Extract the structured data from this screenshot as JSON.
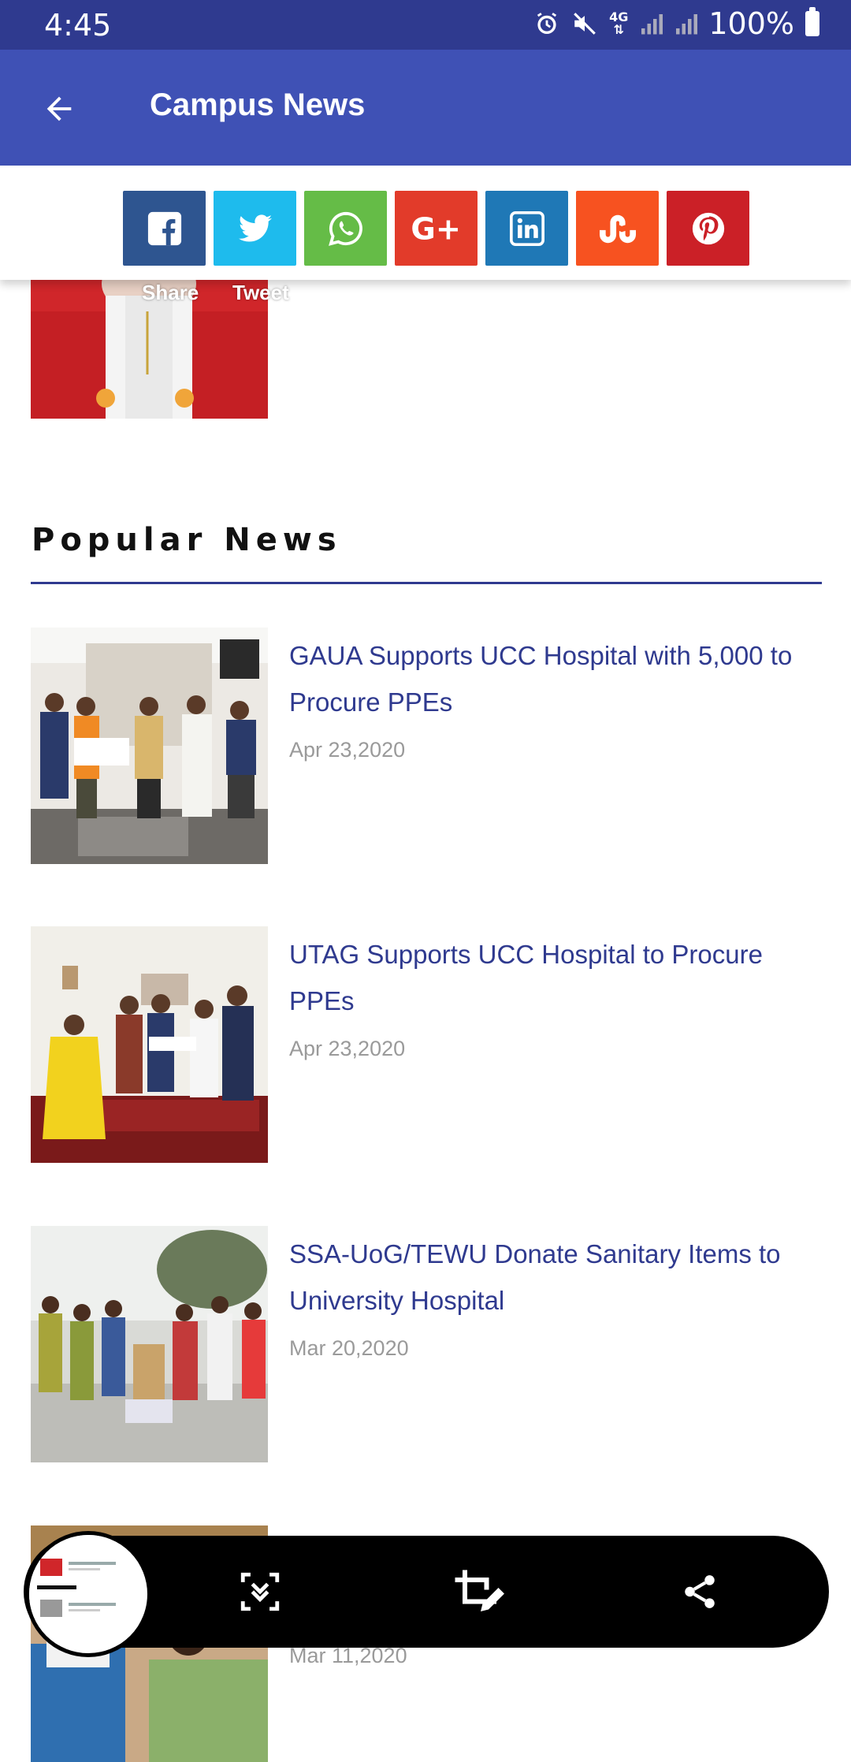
{
  "status_bar": {
    "time": "4:45",
    "network": "4G",
    "battery": "100%"
  },
  "app_bar": {
    "title": "Campus News",
    "back_icon": "arrow-back-icon"
  },
  "share_bar": {
    "buttons": [
      {
        "name": "facebook",
        "icon": "facebook-icon",
        "color": "#2e5590"
      },
      {
        "name": "twitter",
        "icon": "twitter-icon",
        "color": "#1ebbed"
      },
      {
        "name": "whatsapp",
        "icon": "whatsapp-icon",
        "color": "#65bc47"
      },
      {
        "name": "google-plus",
        "icon": "google-plus-icon",
        "color": "#e23b2a"
      },
      {
        "name": "linkedin",
        "icon": "linkedin-icon",
        "color": "#1f78b6"
      },
      {
        "name": "stumbleupon",
        "icon": "stumbleupon-icon",
        "color": "#f75220"
      },
      {
        "name": "pinterest",
        "icon": "pinterest-icon",
        "color": "#cb2027"
      }
    ],
    "captions": {
      "share": "Share",
      "tweet": "Tweet"
    }
  },
  "popular": {
    "heading": "Popular News",
    "items": [
      {
        "title": "GAUA Supports UCC Hospital with 5,000 to Procure PPEs",
        "date": "Apr 23,2020"
      },
      {
        "title": "UTAG Supports UCC Hospital to Procure PPEs",
        "date": "Apr 23,2020"
      },
      {
        "title": "SSA-UoG/TEWU Donate Sanitary Items to University Hospital",
        "date": "Mar 20,2020"
      },
      {
        "title": "",
        "date": "Mar 11,2020"
      }
    ]
  },
  "capture_toolbar": {
    "actions": [
      "scroll-capture-icon",
      "crop-edit-icon",
      "share-icon"
    ]
  },
  "colors": {
    "status_bar": "#2f3a8f",
    "app_bar": "#3f51b5",
    "link_text": "#2f3a8f",
    "date_text": "#9a9a9a"
  }
}
